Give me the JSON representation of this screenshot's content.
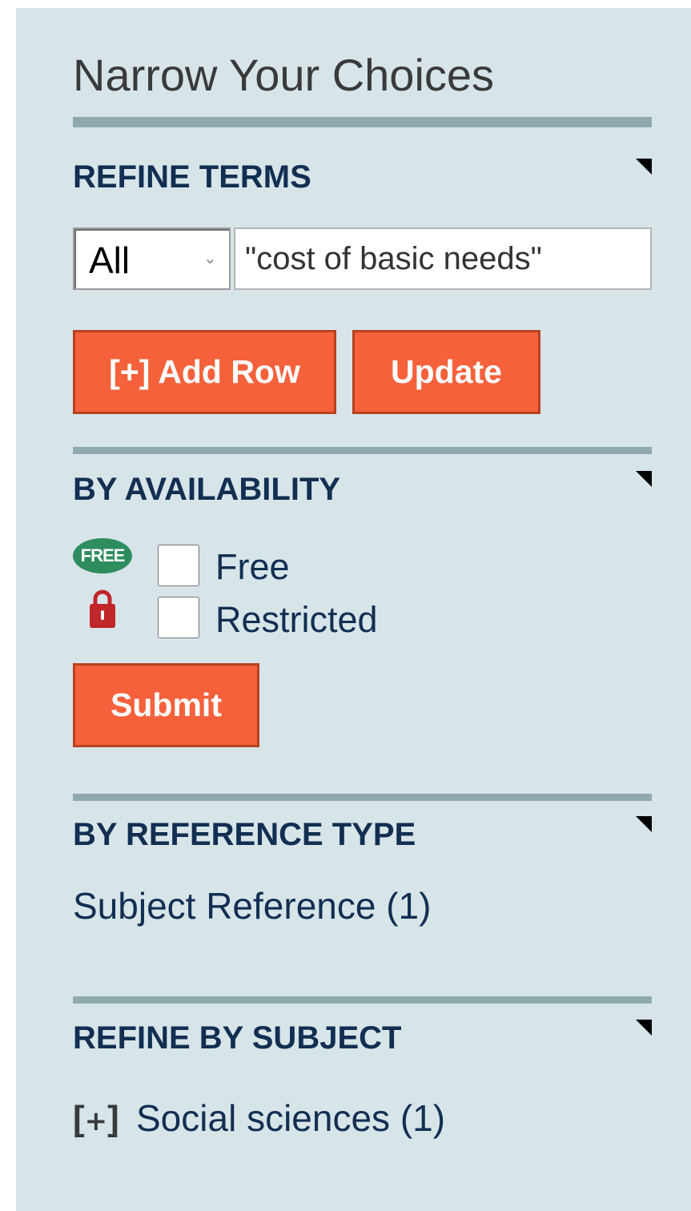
{
  "panel": {
    "title": "Narrow Your Choices"
  },
  "refine_terms": {
    "heading": "REFINE TERMS",
    "field_select": {
      "selected": "All"
    },
    "search_input": {
      "value": "\"cost of basic needs\""
    },
    "add_row_label": "[+] Add Row",
    "update_label": "Update"
  },
  "availability": {
    "heading": "BY AVAILABILITY",
    "options": [
      {
        "icon": "free-badge-icon",
        "badge_text": "FREE",
        "label": "Free",
        "checked": false
      },
      {
        "icon": "lock-icon",
        "label": "Restricted",
        "checked": false
      }
    ],
    "submit_label": "Submit"
  },
  "reference_type": {
    "heading": "BY REFERENCE TYPE",
    "items": [
      {
        "label": "Subject Reference (1)"
      }
    ]
  },
  "subject": {
    "heading": "REFINE BY SUBJECT",
    "items": [
      {
        "expand_icon": "expand-plus-icon",
        "label": "Social sciences (1)"
      }
    ]
  },
  "colors": {
    "panel_bg": "#d7e5e9",
    "divider": "#8eaaaf",
    "heading": "#122f52",
    "button_bg": "#f5613b",
    "button_border": "#b8421f",
    "free_badge": "#2e8d5e",
    "lock": "#c0262a"
  }
}
